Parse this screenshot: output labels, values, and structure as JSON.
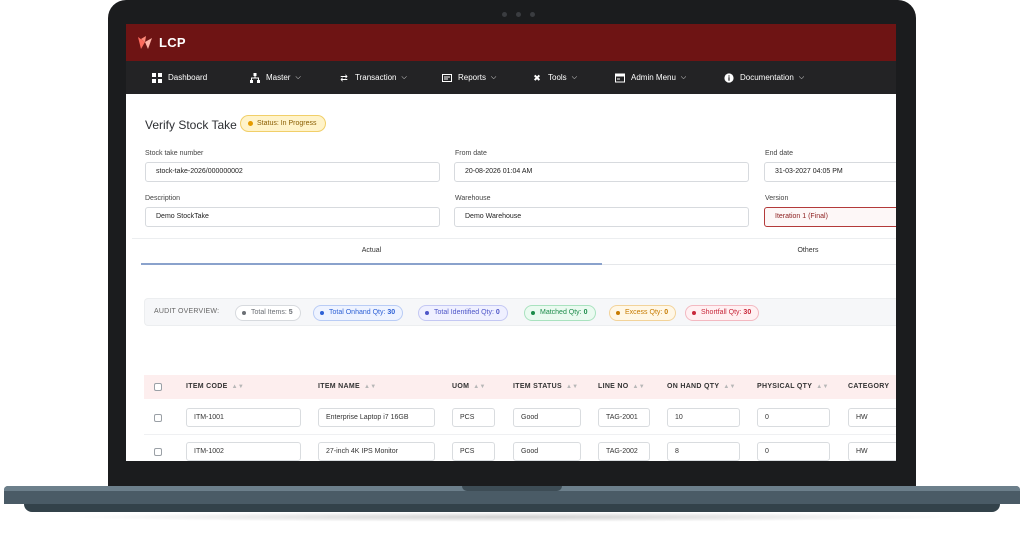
{
  "app": {
    "brand": "LCP"
  },
  "nav": {
    "items": [
      {
        "label": "Dashboard",
        "icon": "grid-icon",
        "has_dropdown": false
      },
      {
        "label": "Master",
        "icon": "hierarchy-icon",
        "has_dropdown": true
      },
      {
        "label": "Transaction",
        "icon": "transfer-icon",
        "has_dropdown": true
      },
      {
        "label": "Reports",
        "icon": "report-icon",
        "has_dropdown": true
      },
      {
        "label": "Tools",
        "icon": "tools-icon",
        "has_dropdown": true
      },
      {
        "label": "Admin Menu",
        "icon": "admin-icon",
        "has_dropdown": true
      },
      {
        "label": "Documentation",
        "icon": "info-icon",
        "has_dropdown": true
      }
    ]
  },
  "page": {
    "title": "Verify Stock Take",
    "status": "Status: In Progress"
  },
  "form": {
    "stock_take_number_label": "Stock take number",
    "stock_take_number": "stock-take-2026/000000002",
    "from_date_label": "From date",
    "from_date": "20-08-2026 01:04 AM",
    "end_date_label": "End date",
    "end_date": "31-03-2027 04:05 PM",
    "description_label": "Description",
    "description": "Demo StockTake",
    "warehouse_label": "Warehouse",
    "warehouse": "Demo Warehouse",
    "version_label": "Version",
    "version": "Iteration 1 (Final)"
  },
  "tabs": [
    {
      "label": "Actual",
      "active": true
    },
    {
      "label": "Others",
      "active": false
    }
  ],
  "audit": {
    "label": "AUDIT OVERVIEW:",
    "pills": [
      {
        "label": "Total Items:",
        "value": "5",
        "color": "#6b6f75",
        "bg": "#ffffff",
        "border": "#d7dade"
      },
      {
        "label": "Total Onhand Qty:",
        "value": "30",
        "color": "#2f62d6",
        "bg": "#eef3ff",
        "border": "#b9ccf5"
      },
      {
        "label": "Total Identified Qty:",
        "value": "0",
        "color": "#4d55c8",
        "bg": "#eff0ff",
        "border": "#c4c8f3"
      },
      {
        "label": "Matched Qty:",
        "value": "0",
        "color": "#1c8c4a",
        "bg": "#eafaf0",
        "border": "#a9e2bf"
      },
      {
        "label": "Excess Qty:",
        "value": "0",
        "color": "#c77b00",
        "bg": "#fff7e6",
        "border": "#f2d39a"
      },
      {
        "label": "Shortfall Qty:",
        "value": "30",
        "color": "#c8283b",
        "bg": "#fff0f2",
        "border": "#f3b9c1"
      }
    ]
  },
  "table": {
    "headers": [
      "ITEM CODE",
      "ITEM NAME",
      "UOM",
      "ITEM STATUS",
      "LINE NO",
      "ON HAND QTY",
      "PHYSICAL QTY",
      "CATEGORY"
    ],
    "rows": [
      [
        "ITM-1001",
        "Enterprise Laptop i7 16GB",
        "PCS",
        "Good",
        "TAG-2001",
        "10",
        "0",
        "HW"
      ],
      [
        "ITM-1002",
        "27-inch 4K IPS Monitor",
        "PCS",
        "Good",
        "TAG-2002",
        "8",
        "0",
        "HW"
      ]
    ]
  }
}
